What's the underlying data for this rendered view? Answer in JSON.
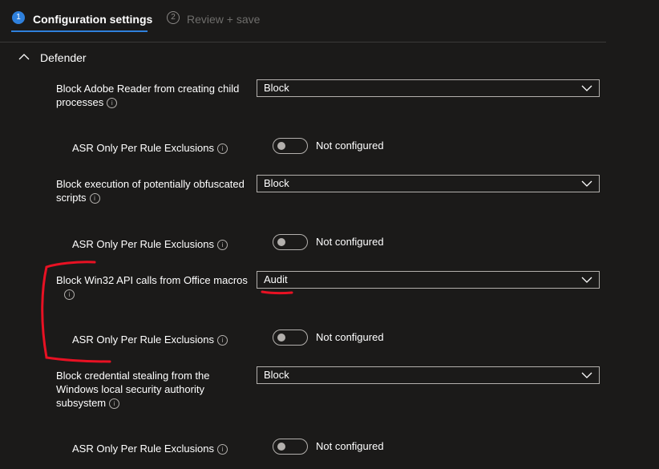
{
  "wizard": {
    "steps": [
      {
        "number": "1",
        "label": "Configuration settings"
      },
      {
        "number": "2",
        "label": "Review + save"
      }
    ]
  },
  "section": {
    "title": "Defender"
  },
  "settings": [
    {
      "label_lines": [
        "Block Adobe Reader from creating child",
        "processes"
      ],
      "value": "Block",
      "exclusion_label": "ASR Only Per Rule Exclusions",
      "exclusion_value": "Not configured"
    },
    {
      "label_lines": [
        "Block execution of potentially obfuscated",
        "scripts"
      ],
      "value": "Block",
      "exclusion_label": "ASR Only Per Rule Exclusions",
      "exclusion_value": "Not configured"
    },
    {
      "label_lines": [
        "Block Win32 API calls from Office macros",
        ""
      ],
      "value": "Audit",
      "exclusion_label": "ASR Only Per Rule Exclusions",
      "exclusion_value": "Not configured"
    },
    {
      "label_lines": [
        "Block credential stealing from the",
        "Windows local security authority",
        "subsystem"
      ],
      "value": "Block",
      "exclusion_label": "ASR Only Per Rule Exclusions",
      "exclusion_value": "Not configured"
    }
  ],
  "icons": {
    "info": "info-icon",
    "chevron_down": "chevron-down-icon",
    "chevron_up": "chevron-up-icon"
  },
  "colors": {
    "background": "#1b1a19",
    "accent": "#2f80dc",
    "annotation": "#e81123"
  }
}
